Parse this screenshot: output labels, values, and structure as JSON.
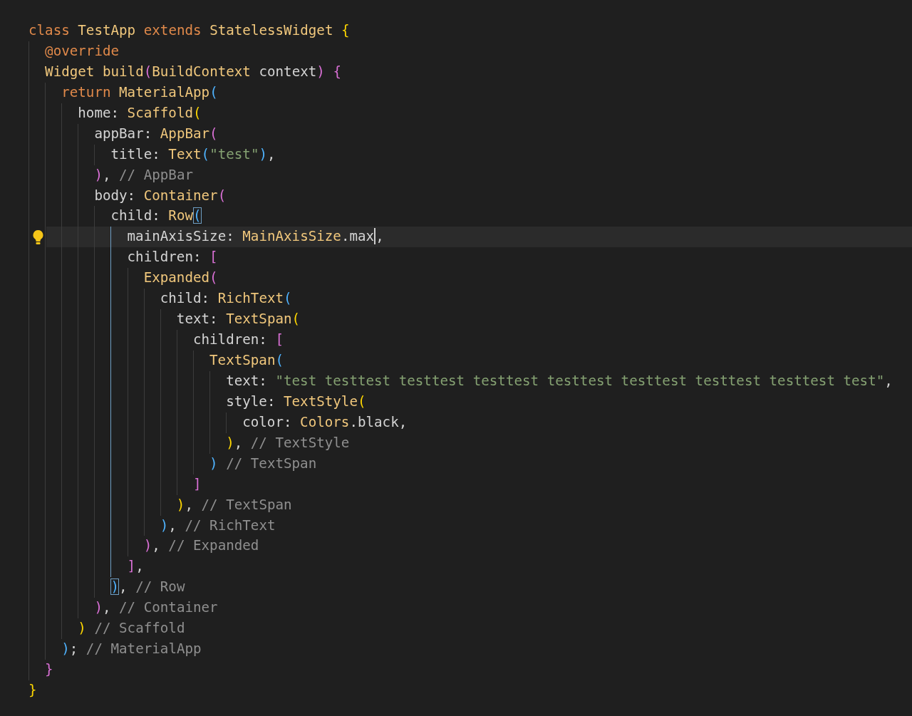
{
  "editor": {
    "lines": [
      {
        "tokens": [
          {
            "kind": "keyword",
            "text": "class "
          },
          {
            "kind": "type",
            "text": "TestApp "
          },
          {
            "kind": "keyword",
            "text": "extends "
          },
          {
            "kind": "type",
            "text": "StatelessWidget "
          },
          {
            "kind": "bracket_yellow",
            "text": "{"
          }
        ]
      },
      {
        "tokens": [
          {
            "kind": "keyword",
            "text": "  @override"
          }
        ]
      },
      {
        "tokens": [
          {
            "kind": "type",
            "text": "  Widget build"
          },
          {
            "kind": "bracket_pink",
            "text": "("
          },
          {
            "kind": "type",
            "text": "BuildContext "
          },
          {
            "kind": "plain",
            "text": "context"
          },
          {
            "kind": "bracket_pink",
            "text": ")"
          },
          {
            "kind": "bracket_pink",
            "text": " {"
          }
        ]
      },
      {
        "tokens": [
          {
            "kind": "keyword",
            "text": "    return "
          },
          {
            "kind": "type",
            "text": "MaterialApp"
          },
          {
            "kind": "bracket_blue",
            "text": "("
          }
        ]
      },
      {
        "tokens": [
          {
            "kind": "plain",
            "text": "      home: "
          },
          {
            "kind": "type",
            "text": "Scaffold"
          },
          {
            "kind": "bracket_yellow",
            "text": "("
          }
        ]
      },
      {
        "tokens": [
          {
            "kind": "plain",
            "text": "        appBar: "
          },
          {
            "kind": "type",
            "text": "AppBar"
          },
          {
            "kind": "bracket_pink",
            "text": "("
          }
        ]
      },
      {
        "tokens": [
          {
            "kind": "plain",
            "text": "          title: "
          },
          {
            "kind": "type",
            "text": "Text"
          },
          {
            "kind": "bracket_blue",
            "text": "("
          },
          {
            "kind": "string",
            "text": "\"test\""
          },
          {
            "kind": "bracket_blue",
            "text": ")"
          },
          {
            "kind": "plain",
            "text": ","
          }
        ]
      },
      {
        "tokens": [
          {
            "kind": "bracket_pink",
            "text": "        )"
          },
          {
            "kind": "plain",
            "text": ","
          },
          {
            "kind": "comment",
            "text": " // AppBar"
          }
        ]
      },
      {
        "tokens": [
          {
            "kind": "plain",
            "text": "        body: "
          },
          {
            "kind": "type",
            "text": "Container"
          },
          {
            "kind": "bracket_pink",
            "text": "("
          }
        ]
      },
      {
        "tokens": [
          {
            "kind": "plain",
            "text": "          child: "
          },
          {
            "kind": "type",
            "text": "Row"
          },
          {
            "kind": "bracket_blue",
            "text": "(",
            "matched": true
          }
        ]
      },
      {
        "current": true,
        "active_guide": true,
        "tokens": [
          {
            "kind": "plain",
            "text": "            mainAxisSize: "
          },
          {
            "kind": "type",
            "text": "MainAxisSize"
          },
          {
            "kind": "plain",
            "text": ".max",
            "cursor": true
          },
          {
            "kind": "plain",
            "text": ","
          }
        ]
      },
      {
        "active_guide": true,
        "tokens": [
          {
            "kind": "plain",
            "text": "            children: "
          },
          {
            "kind": "bracket_pink",
            "text": "["
          }
        ]
      },
      {
        "active_guide": true,
        "tokens": [
          {
            "kind": "type",
            "text": "              Expanded"
          },
          {
            "kind": "bracket_pink",
            "text": "("
          }
        ]
      },
      {
        "active_guide": true,
        "tokens": [
          {
            "kind": "plain",
            "text": "                child: "
          },
          {
            "kind": "type",
            "text": "RichText"
          },
          {
            "kind": "bracket_blue",
            "text": "("
          }
        ]
      },
      {
        "active_guide": true,
        "tokens": [
          {
            "kind": "plain",
            "text": "                  text: "
          },
          {
            "kind": "type",
            "text": "TextSpan"
          },
          {
            "kind": "bracket_yellow",
            "text": "("
          }
        ]
      },
      {
        "active_guide": true,
        "tokens": [
          {
            "kind": "plain",
            "text": "                    children: "
          },
          {
            "kind": "bracket_pink",
            "text": "["
          }
        ]
      },
      {
        "active_guide": true,
        "tokens": [
          {
            "kind": "type",
            "text": "                      TextSpan"
          },
          {
            "kind": "bracket_blue",
            "text": "("
          }
        ]
      },
      {
        "active_guide": true,
        "tokens": [
          {
            "kind": "plain",
            "text": "                        text: "
          },
          {
            "kind": "string",
            "text": "\"test testtest testtest testtest testtest testtest testtest testtest test\""
          },
          {
            "kind": "plain",
            "text": ","
          }
        ]
      },
      {
        "active_guide": true,
        "tokens": [
          {
            "kind": "plain",
            "text": "                        style: "
          },
          {
            "kind": "type",
            "text": "TextStyle"
          },
          {
            "kind": "bracket_yellow",
            "text": "("
          }
        ]
      },
      {
        "active_guide": true,
        "tokens": [
          {
            "kind": "plain",
            "text": "                          color: "
          },
          {
            "kind": "type",
            "text": "Colors"
          },
          {
            "kind": "plain",
            "text": ".black,"
          }
        ]
      },
      {
        "active_guide": true,
        "tokens": [
          {
            "kind": "bracket_yellow",
            "text": "                        )"
          },
          {
            "kind": "plain",
            "text": ","
          },
          {
            "kind": "comment",
            "text": " // TextStyle"
          }
        ]
      },
      {
        "active_guide": true,
        "tokens": [
          {
            "kind": "bracket_blue",
            "text": "                      )"
          },
          {
            "kind": "comment",
            "text": " // TextSpan"
          }
        ]
      },
      {
        "active_guide": true,
        "tokens": [
          {
            "kind": "bracket_pink",
            "text": "                    ]"
          }
        ]
      },
      {
        "active_guide": true,
        "tokens": [
          {
            "kind": "bracket_yellow",
            "text": "                  )"
          },
          {
            "kind": "plain",
            "text": ","
          },
          {
            "kind": "comment",
            "text": " // TextSpan"
          }
        ]
      },
      {
        "active_guide": true,
        "tokens": [
          {
            "kind": "bracket_blue",
            "text": "                )"
          },
          {
            "kind": "plain",
            "text": ","
          },
          {
            "kind": "comment",
            "text": " // RichText"
          }
        ]
      },
      {
        "active_guide": true,
        "tokens": [
          {
            "kind": "bracket_pink",
            "text": "              )"
          },
          {
            "kind": "plain",
            "text": ","
          },
          {
            "kind": "comment",
            "text": " // Expanded"
          }
        ]
      },
      {
        "active_guide": true,
        "tokens": [
          {
            "kind": "bracket_pink",
            "text": "            ]"
          },
          {
            "kind": "plain",
            "text": ","
          }
        ]
      },
      {
        "tokens": [
          {
            "kind": "bracket_blue",
            "text": "          )",
            "matched": true
          },
          {
            "kind": "plain",
            "text": ","
          },
          {
            "kind": "comment",
            "text": " // Row"
          }
        ]
      },
      {
        "tokens": [
          {
            "kind": "bracket_pink",
            "text": "        )"
          },
          {
            "kind": "plain",
            "text": ","
          },
          {
            "kind": "comment",
            "text": " // Container"
          }
        ]
      },
      {
        "tokens": [
          {
            "kind": "bracket_yellow",
            "text": "      )"
          },
          {
            "kind": "comment",
            "text": " // Scaffold"
          }
        ]
      },
      {
        "tokens": [
          {
            "kind": "bracket_blue",
            "text": "    )"
          },
          {
            "kind": "plain",
            "text": ";"
          },
          {
            "kind": "comment",
            "text": " // MaterialApp"
          }
        ]
      },
      {
        "tokens": [
          {
            "kind": "bracket_pink",
            "text": "  }"
          }
        ]
      },
      {
        "tokens": [
          {
            "kind": "bracket_yellow",
            "text": "}"
          }
        ]
      }
    ]
  }
}
